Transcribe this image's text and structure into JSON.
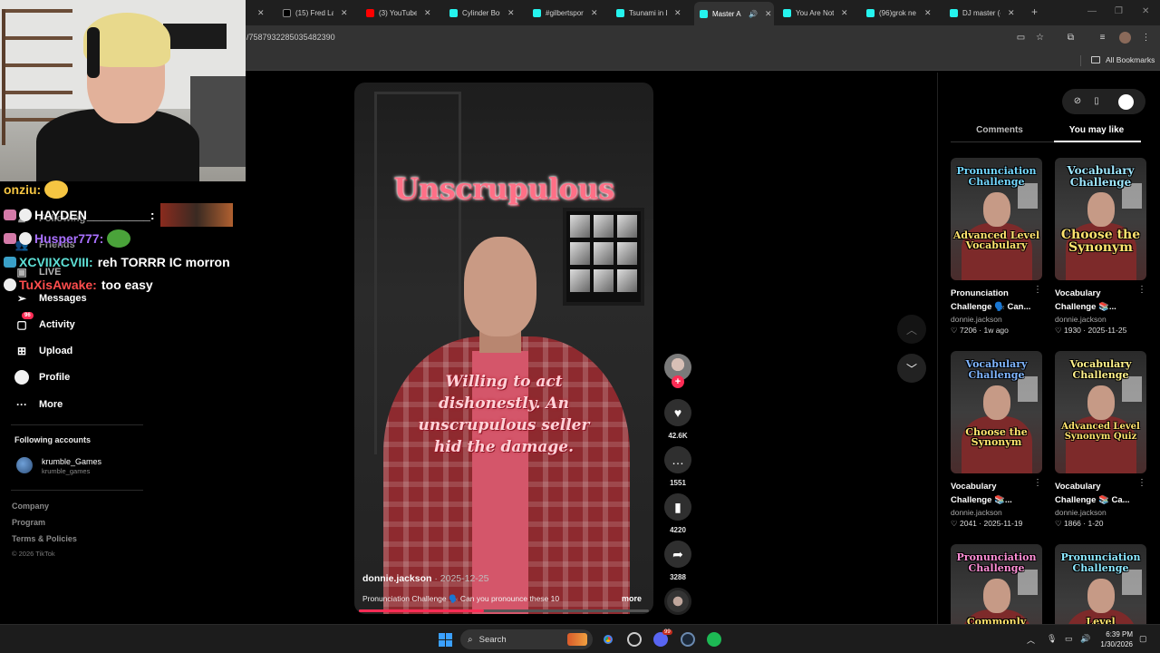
{
  "browser": {
    "tabs": [
      {
        "title": "",
        "color": "#c0392b",
        "active": false
      },
      {
        "title": "(15) Fred Las",
        "color": "#000000",
        "active": false
      },
      {
        "title": "(3) YouTube",
        "color": "#ff0000",
        "active": false
      },
      {
        "title": "Cylinder Bou",
        "color": "#25f4ee",
        "active": false
      },
      {
        "title": "#gilbertspor",
        "color": "#25f4ee",
        "active": false
      },
      {
        "title": "Tsunami in L",
        "color": "#25f4ee",
        "active": false
      },
      {
        "title": "Master A",
        "color": "#25f4ee",
        "active": true
      },
      {
        "title": "You Are Not",
        "color": "#25f4ee",
        "active": false
      },
      {
        "title": "(96)grok ne",
        "color": "#25f4ee",
        "active": false
      },
      {
        "title": "DJ master (c",
        "color": "#25f4ee",
        "active": false
      }
    ],
    "url": "/7587932285035482390",
    "all_bookmarks": "All Bookmarks"
  },
  "chat": [
    {
      "user": "onziu:",
      "user_color": "#f5c542",
      "message": ""
    },
    {
      "user": "HAYDEN_________:",
      "user_color": "#ffffff",
      "message": ""
    },
    {
      "user": "Husper777:",
      "user_color": "#a970ff",
      "message": ""
    },
    {
      "user": "XCVIIXCVIII:",
      "user_color": "#5ee0d6",
      "message": "reh TORRR IC morron"
    },
    {
      "user": "TuXisAwake:",
      "user_color": "#ff4d4d",
      "message": "too easy"
    }
  ],
  "sidebar": {
    "partial_items": [
      "Following",
      "Friends",
      "LIVE"
    ],
    "items": [
      {
        "label": "Messages",
        "icon": "paper-plane-icon"
      },
      {
        "label": "Activity",
        "icon": "activity-icon",
        "badge": "96"
      },
      {
        "label": "Upload",
        "icon": "upload-icon"
      },
      {
        "label": "Profile",
        "icon": "profile-icon"
      },
      {
        "label": "More",
        "icon": "more-icon"
      }
    ],
    "following_heading": "Following accounts",
    "following": [
      {
        "name": "krumble_Games",
        "handle": "krumble_games"
      }
    ],
    "footer_links": [
      "Company",
      "Program",
      "Terms & Policies"
    ],
    "copyright": "© 2026 TikTok"
  },
  "video": {
    "word": "Unscrupulous",
    "definition": "Willing to act dishonestly. An unscrupulous seller hid the damage.",
    "author": "donnie.jackson",
    "date": " · 2025-12-25",
    "caption": "Pronunciation Challenge 🗣️ Can you pronounce these 10",
    "more": "more",
    "progress": 0.43
  },
  "actions": {
    "likes": "42.6K",
    "comments": "1551",
    "saves": "4220",
    "shares": "3288"
  },
  "right_panel": {
    "tabs": [
      "Comments",
      "You may like"
    ],
    "active_tab": "You may like",
    "cards": [
      {
        "top": "Pronunciation Challenge",
        "bottom": "Advanced Level Vocabulary",
        "title": "Pronunciation Challenge 🗣️ Can...",
        "author": "donnie.jackson",
        "likes": "7206",
        "date": "1w ago"
      },
      {
        "top": "Vocabulary Challenge",
        "bottom": "Choose the Synonym",
        "title": "Vocabulary Challenge 📚...",
        "author": "donnie.jackson",
        "likes": "1930",
        "date": "2025-11-25"
      },
      {
        "top": "Vocabulary Challenge",
        "bottom": "Choose the Synonym",
        "title": "Vocabulary Challenge 📚...",
        "author": "donnie.jackson",
        "likes": "2041",
        "date": "2025-11-19"
      },
      {
        "top": "Vocabulary Challenge",
        "bottom": "Advanced Level Synonym Quiz",
        "title": "Vocabulary Challenge 📚 Ca...",
        "author": "donnie.jackson",
        "likes": "1866",
        "date": "1-20"
      },
      {
        "top": "Pronunciation Challenge",
        "bottom": "Commonly",
        "title": "",
        "author": "",
        "likes": "",
        "date": ""
      },
      {
        "top": "Pronunciation Challenge",
        "bottom": "Level",
        "title": "",
        "author": "",
        "likes": "",
        "date": ""
      }
    ]
  },
  "taskbar": {
    "search_label": "Search",
    "discord_badge": "99",
    "time": "6:39 PM",
    "date": "1/30/2026"
  }
}
